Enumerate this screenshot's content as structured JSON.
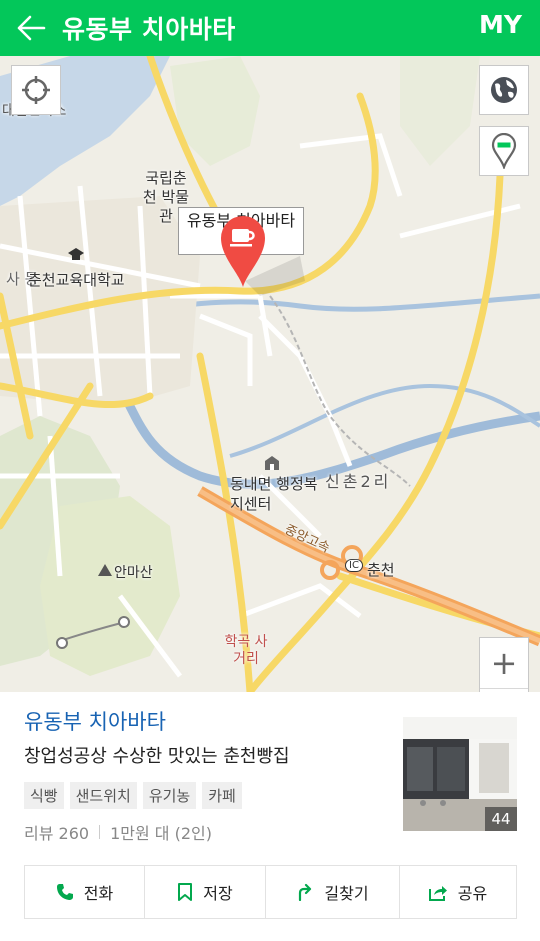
{
  "header": {
    "title": "유동부 치아바타",
    "my_label": "MY",
    "back_icon": "arrow-left-icon",
    "bg_color": "#03c75a"
  },
  "map": {
    "marker_callout": "유동부 치아바타",
    "marker_icon": "coffee-cup-icon",
    "marker_color": "#f04b43",
    "labels": {
      "museum": "국립춘천 박물관",
      "university": "춘천교육대학교",
      "district_edge": "사 동",
      "office": "동내면 행정복지센터",
      "village": "신촌2리",
      "highway": "중앙고속",
      "ic": "IC",
      "ic_name": "춘천",
      "mountain": "안마산",
      "crossroad": "학곡 사거리",
      "top_clip": "대한민국스"
    },
    "controls": {
      "locate_icon": "crosshair-icon",
      "globe_icon": "globe-icon",
      "pin_icon": "map-pin-icon",
      "zoom_in": "+",
      "zoom_out": "−"
    }
  },
  "place": {
    "name": "유동부 치아바타",
    "description": "창업성공상 수상한 맛있는 춘천빵집",
    "tags": [
      "식빵",
      "샌드위치",
      "유기농",
      "카페"
    ],
    "reviews": "리뷰 260",
    "price": "1만원 대 (2인)",
    "photo_count": "44",
    "name_color": "#1863b3"
  },
  "actions": [
    {
      "label": "전화",
      "icon": "phone-icon"
    },
    {
      "label": "저장",
      "icon": "bookmark-icon"
    },
    {
      "label": "길찾기",
      "icon": "directions-icon"
    },
    {
      "label": "공유",
      "icon": "share-icon"
    }
  ]
}
